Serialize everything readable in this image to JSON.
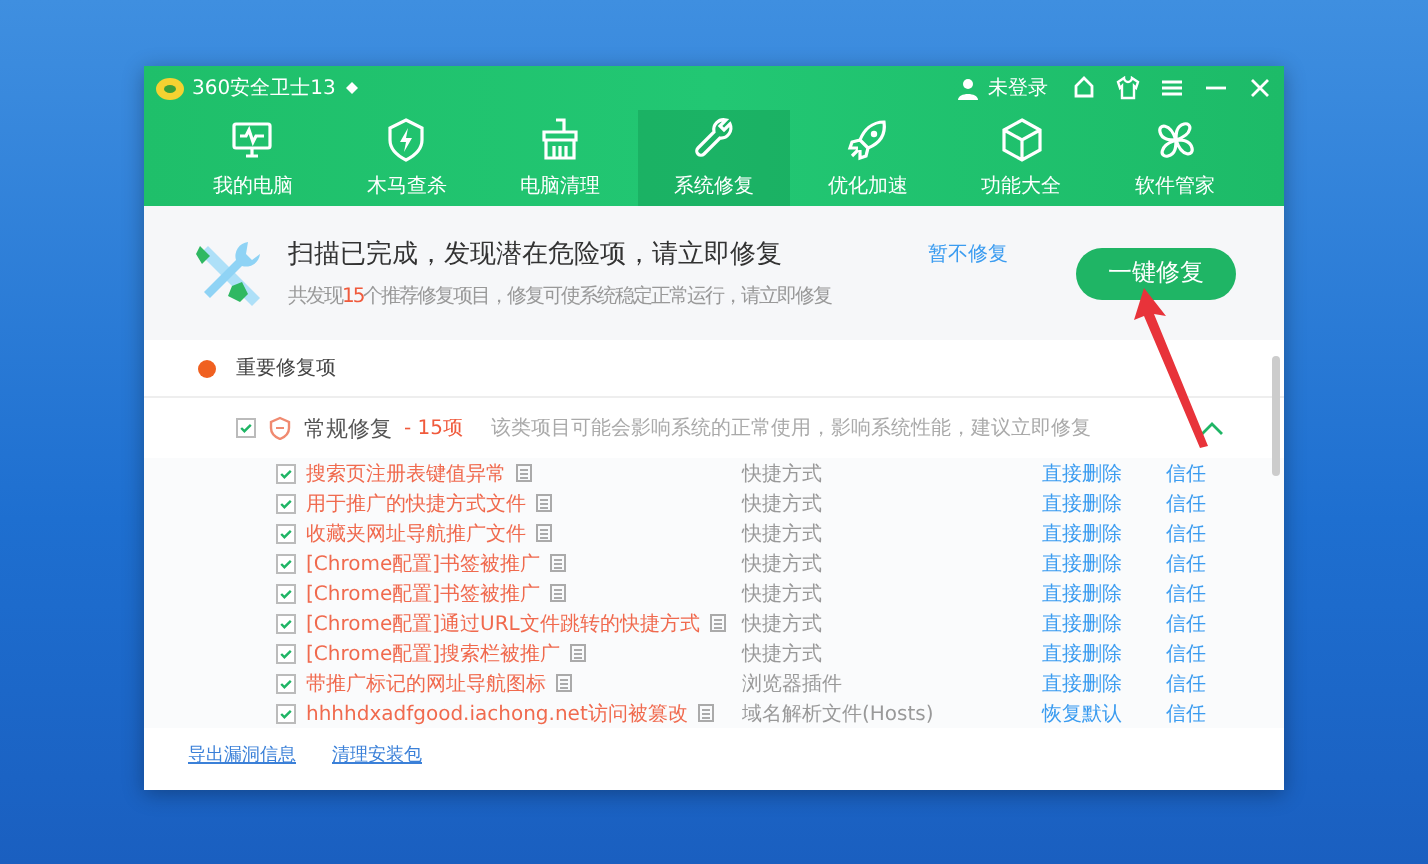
{
  "window": {
    "title": "360安全卫士13",
    "user": "未登录"
  },
  "nav": [
    {
      "label": "我的电脑",
      "selected": false
    },
    {
      "label": "木马查杀",
      "selected": false
    },
    {
      "label": "电脑清理",
      "selected": false
    },
    {
      "label": "系统修复",
      "selected": true
    },
    {
      "label": "优化加速",
      "selected": false
    },
    {
      "label": "功能大全",
      "selected": false
    },
    {
      "label": "软件管家",
      "selected": false
    }
  ],
  "banner": {
    "title": "扫描已完成，发现潜在危险项，请立即修复",
    "summary_before": "共发现",
    "summary_count": "15",
    "summary_after": "个推荐修复项目，修复可使系统稳定正常运行，请立即修复",
    "skip_link": "暂不修复",
    "fix_button": "一键修复"
  },
  "section": {
    "title": "重要修复项"
  },
  "group": {
    "title": "常规修复",
    "count": "- 15项",
    "description": "该类项目可能会影响系统的正常使用，影响系统性能，建议立即修复",
    "checked": true,
    "expanded": true
  },
  "items": [
    {
      "name": "搜索页注册表键值异常",
      "type": "快捷方式",
      "action": "直接删除",
      "trust": "信任",
      "checked": true
    },
    {
      "name": "用于推广的快捷方式文件",
      "type": "快捷方式",
      "action": "直接删除",
      "trust": "信任",
      "checked": true
    },
    {
      "name": "收藏夹网址导航推广文件",
      "type": "快捷方式",
      "action": "直接删除",
      "trust": "信任",
      "checked": true
    },
    {
      "name": "[Chrome配置]书签被推广",
      "type": "快捷方式",
      "action": "直接删除",
      "trust": "信任",
      "checked": true
    },
    {
      "name": "[Chrome配置]书签被推广",
      "type": "快捷方式",
      "action": "直接删除",
      "trust": "信任",
      "checked": true
    },
    {
      "name": "[Chrome配置]通过URL文件跳转的快捷方式",
      "type": "快捷方式",
      "action": "直接删除",
      "trust": "信任",
      "checked": true
    },
    {
      "name": "[Chrome配置]搜索栏被推广",
      "type": "快捷方式",
      "action": "直接删除",
      "trust": "信任",
      "checked": true
    },
    {
      "name": "带推广标记的网址导航图标",
      "type": "浏览器插件",
      "action": "直接删除",
      "trust": "信任",
      "checked": true
    },
    {
      "name": "hhhhdxadfgood.iachong.net访问被篡改",
      "type": "域名解析文件(Hosts)",
      "action": "恢复默认",
      "trust": "信任",
      "checked": true
    }
  ],
  "footer": {
    "links": [
      "导出漏洞信息",
      "清理安装包"
    ]
  }
}
